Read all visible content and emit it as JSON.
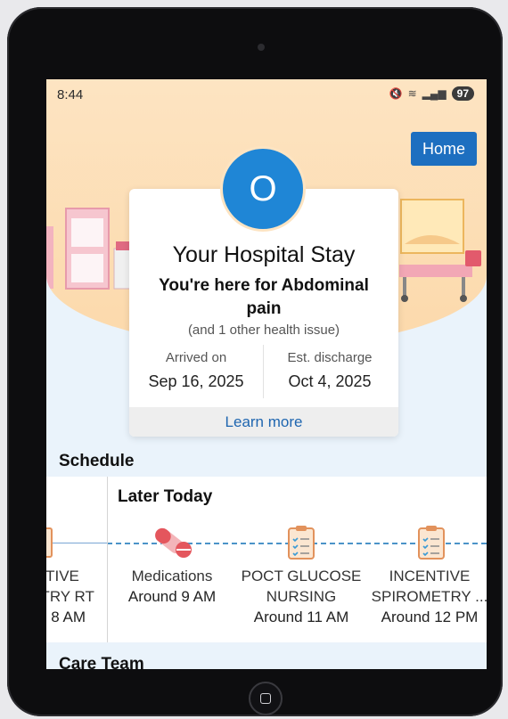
{
  "status_bar": {
    "time": "8:44",
    "battery": "97"
  },
  "header": {
    "home_label": "Home"
  },
  "stay_card": {
    "avatar_initial": "O",
    "title": "Your Hospital Stay",
    "reason": "You're here for Abdominal pain",
    "other_issues": "(and 1 other health issue)",
    "arrived_label": "Arrived on",
    "arrived_date": "Sep 16, 2025",
    "discharge_label": "Est. discharge",
    "discharge_date": "Oct 4, 2025",
    "learn_more": "Learn more"
  },
  "schedule": {
    "title": "Schedule",
    "later_label": "Later Today",
    "past_item": {
      "line1": "TIVE",
      "line2": "ETRY RT",
      "time": "8 AM"
    },
    "items": [
      {
        "icon": "pill-icon",
        "line1": "Medications",
        "line2": "",
        "time": "Around 9 AM"
      },
      {
        "icon": "clipboard-icon",
        "line1": "POCT GLUCOSE",
        "line2": "NURSING",
        "time": "Around 11 AM"
      },
      {
        "icon": "clipboard-icon",
        "line1": "INCENTIVE",
        "line2": "SPIROMETRY ...",
        "time": "Around 12 PM"
      }
    ]
  },
  "care_team": {
    "title": "Care Team"
  },
  "colors": {
    "accent": "#1f86d6",
    "home_button": "#1d6fc0",
    "hero": "#fde4c2",
    "pill": "#e4565d"
  }
}
